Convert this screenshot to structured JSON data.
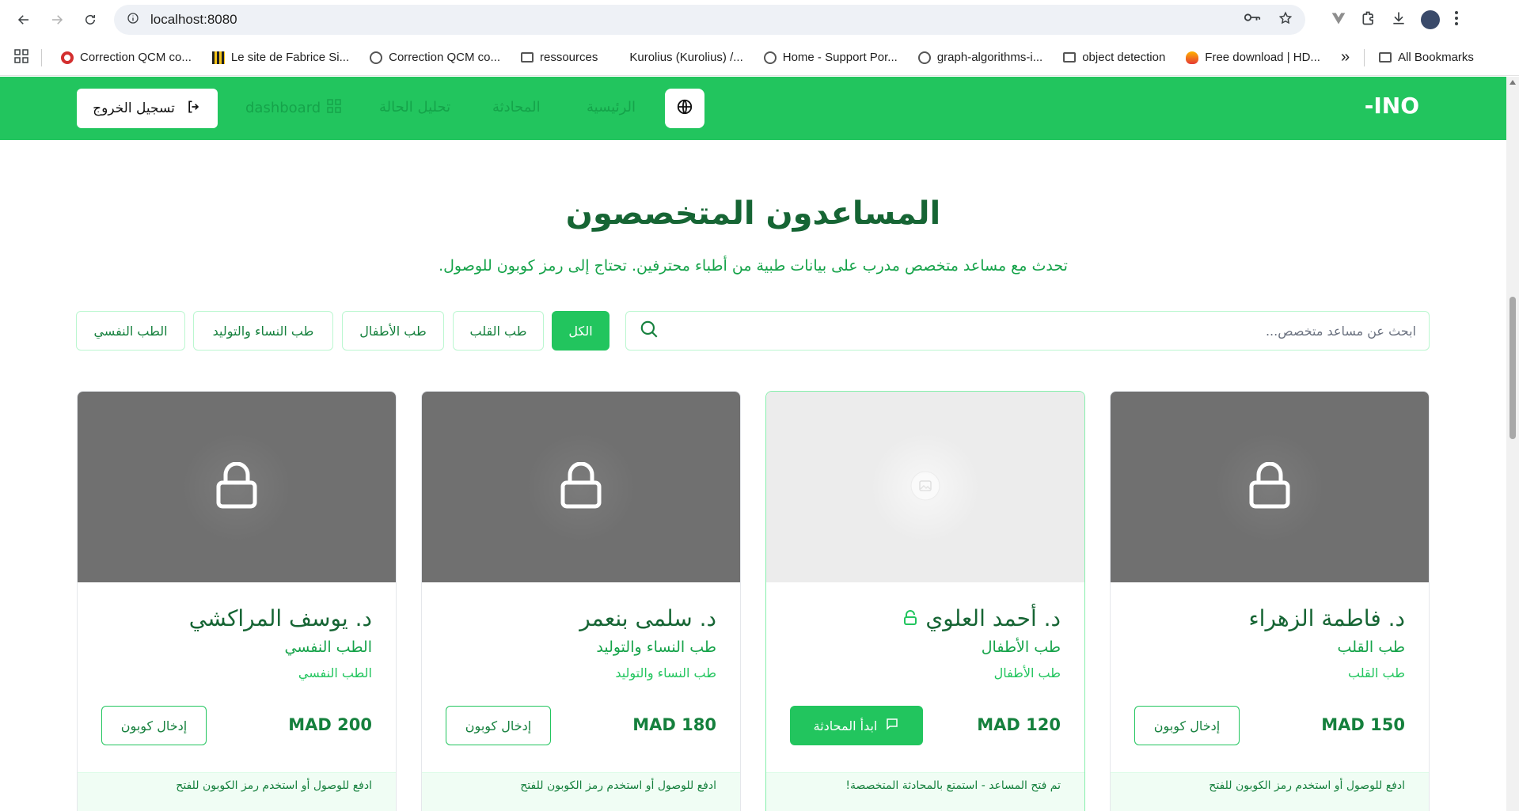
{
  "browser": {
    "url": "localhost:8080",
    "bookmarks": [
      {
        "label": "Correction QCM co...",
        "icon": "target-icon"
      },
      {
        "label": "Le site de Fabrice Si...",
        "icon": "qr-icon"
      },
      {
        "label": "Correction QCM co...",
        "icon": "globe-icon"
      },
      {
        "label": "ressources",
        "icon": "folder-icon"
      },
      {
        "label": "Kurolius (Kurolius) /...",
        "icon": "none"
      },
      {
        "label": "Home - Support Por...",
        "icon": "globe-icon"
      },
      {
        "label": "graph-algorithms-i...",
        "icon": "globe-icon"
      },
      {
        "label": "object detection",
        "icon": "folder-icon"
      },
      {
        "label": "Free download | HD...",
        "icon": "fire-icon"
      }
    ],
    "more": "»",
    "all_bookmarks": "All Bookmarks"
  },
  "navbar": {
    "logo": "-INO",
    "links": {
      "home": "الرئيسية",
      "chat": "المحادثة",
      "analysis": "تحليل الحالة",
      "dashboard": "dashboard"
    },
    "logout": "تسجيل الخروج"
  },
  "main": {
    "title": "المساعدون المتخصصون",
    "subtitle": "تحدث مع مساعد متخصص مدرب على بيانات طبية من أطباء محترفين. تحتاج إلى رمز كوبون للوصول.",
    "search_placeholder": "ابحث عن مساعد متخصص...",
    "filters": [
      "الكل",
      "طب القلب",
      "طب الأطفال",
      "طب النساء والتوليد",
      "الطب النفسي"
    ]
  },
  "cards": [
    {
      "name": "د. فاطمة الزهراء",
      "spec": "طب القلب",
      "spec2": "طب القلب",
      "price": "MAD 150",
      "button": "إدخال كوبون",
      "footer": "ادفع للوصول أو استخدم رمز الكوبون للفتح",
      "locked": true
    },
    {
      "name": "د. أحمد العلوي",
      "spec": "طب الأطفال",
      "spec2": "طب الأطفال",
      "price": "MAD 120",
      "button": "ابدأ المحادثة",
      "footer": "تم فتح المساعد - استمتع بالمحادثة المتخصصة!",
      "locked": false
    },
    {
      "name": "د. سلمى بنعمر",
      "spec": "طب النساء والتوليد",
      "spec2": "طب النساء والتوليد",
      "price": "MAD 180",
      "button": "إدخال كوبون",
      "footer": "ادفع للوصول أو استخدم رمز الكوبون للفتح",
      "locked": true
    },
    {
      "name": "د. يوسف المراكشي",
      "spec": "الطب النفسي",
      "spec2": "الطب النفسي",
      "price": "MAD 200",
      "button": "إدخال كوبون",
      "footer": "ادفع للوصول أو استخدم رمز الكوبون للفتح",
      "locked": true
    }
  ],
  "colors": {
    "brand": "#22c55e",
    "dark_green": "#166534"
  }
}
